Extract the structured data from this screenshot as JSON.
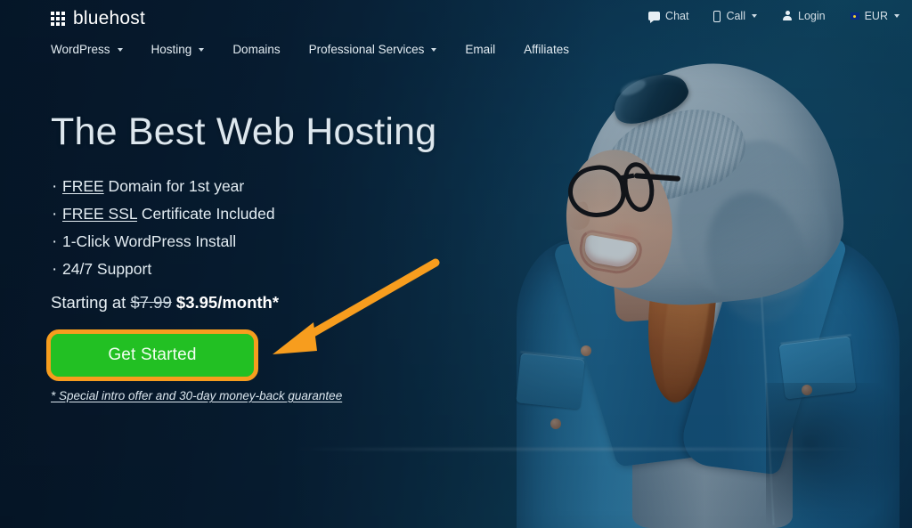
{
  "brand": {
    "name": "bluehost",
    "logo_icon": "grid-squares-icon"
  },
  "utility_nav": [
    {
      "label": "Chat",
      "icon": "chat-bubble-icon",
      "caret": false
    },
    {
      "label": "Call",
      "icon": "phone-icon",
      "caret": true
    },
    {
      "label": "Login",
      "icon": "user-icon",
      "caret": false
    },
    {
      "label": "EUR",
      "icon": "eu-flag-icon",
      "caret": true
    }
  ],
  "main_nav": [
    {
      "label": "WordPress",
      "caret": true
    },
    {
      "label": "Hosting",
      "caret": true
    },
    {
      "label": "Domains",
      "caret": false
    },
    {
      "label": "Professional Services",
      "caret": true
    },
    {
      "label": "Email",
      "caret": false
    },
    {
      "label": "Affiliates",
      "caret": false
    }
  ],
  "hero": {
    "headline": "The Best Web Hosting",
    "bullets": [
      {
        "emphasis": "FREE",
        "rest": " Domain for 1st year"
      },
      {
        "emphasis": "FREE SSL",
        "rest": " Certificate Included"
      },
      {
        "emphasis": "",
        "rest": "1-Click WordPress Install"
      },
      {
        "emphasis": "",
        "rest": "24/7 Support"
      }
    ],
    "pricing_prefix": "Starting at ",
    "price_old": "$7.99",
    "price_new": " $3.95/month*",
    "cta_label": "Get Started",
    "footnote": "* Special intro offer and 30-day money-back guarantee"
  },
  "annotation": {
    "arrow_color": "#f79d1e",
    "highlight_color": "#f79d1e",
    "target": "get-started-button"
  },
  "colors": {
    "cta_green": "#22c023",
    "accent_orange": "#f79d1e",
    "bg_navy": "#0a2340",
    "bg_teal": "#11536f",
    "text_light": "#e3ecf2"
  },
  "photo": {
    "alt": "smiling young woman with glasses, grey beanie hood and denim jacket"
  }
}
